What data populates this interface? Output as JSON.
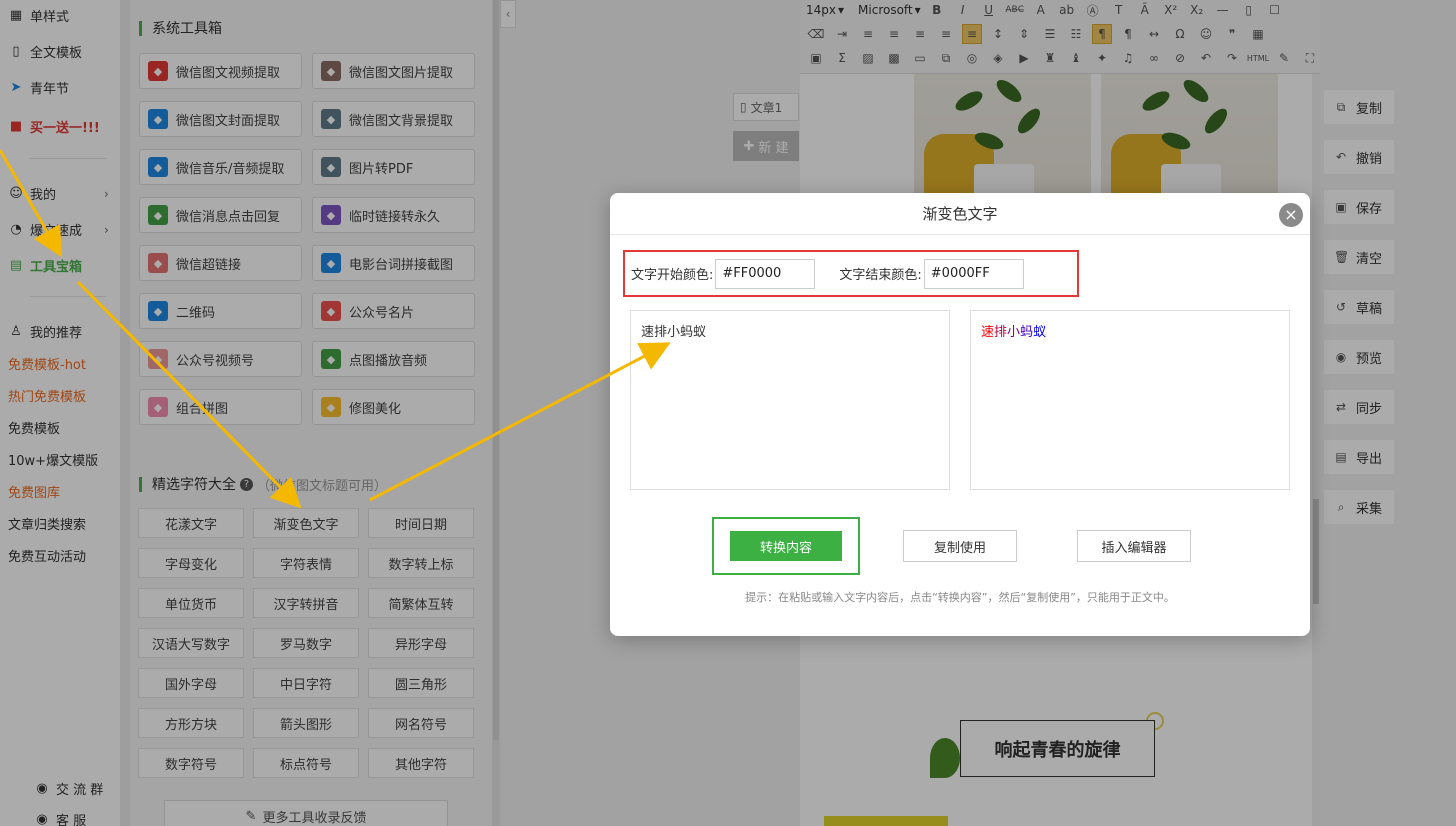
{
  "left_nav": {
    "items": [
      {
        "label": "单样式",
        "icon": "grid-icon"
      },
      {
        "label": "全文模板",
        "icon": "layout-icon"
      },
      {
        "label": "青年节",
        "icon": "paper-plane-icon"
      },
      {
        "label": "买一送一!!!",
        "icon": "gift-icon",
        "color": "#e53935"
      },
      {
        "label": "我的",
        "icon": "user-icon",
        "chevron": true
      },
      {
        "label": "爆文速成",
        "icon": "flame-icon",
        "chevron": true
      },
      {
        "label": "工具宝箱",
        "icon": "toolbox-icon",
        "color": "#4caf50"
      },
      {
        "label": "我的推荐",
        "icon": "thumbs-up-icon"
      },
      {
        "label": "免费模板-hot",
        "color": "#f06b1e"
      },
      {
        "label": "热门免费模板",
        "color": "#f06b1e"
      },
      {
        "label": "免费模板"
      },
      {
        "label": "10w+爆文模版"
      },
      {
        "label": "免费图库",
        "color": "#f06b1e"
      },
      {
        "label": "文章归类搜索"
      },
      {
        "label": "免费互动活动"
      }
    ],
    "bottom": [
      {
        "label": "交 流 群",
        "icon": "chat-icon"
      },
      {
        "label": "客 服",
        "icon": "headset-icon"
      }
    ]
  },
  "tools": {
    "section_title": "系统工具箱",
    "buttons": [
      {
        "label": "微信图文视频提取",
        "icon": "video-icon",
        "color": "#e53935"
      },
      {
        "label": "微信图文图片提取",
        "icon": "image-icon",
        "color": "#8d6e63"
      },
      {
        "label": "微信图文封面提取",
        "icon": "picture-icon",
        "color": "#1e88e5"
      },
      {
        "label": "微信图文背景提取",
        "icon": "background-icon",
        "color": "#607d8b"
      },
      {
        "label": "微信音乐/音频提取",
        "icon": "headphone-icon",
        "color": "#1e88e5"
      },
      {
        "label": "图片转PDF",
        "icon": "pdf-icon",
        "color": "#607d8b"
      },
      {
        "label": "微信消息点击回复",
        "icon": "message-icon",
        "color": "#43a047"
      },
      {
        "label": "临时链接转永久",
        "icon": "link-icon",
        "color": "#7e57c2"
      },
      {
        "label": "微信超链接",
        "icon": "hyperlink-icon",
        "color": "#e57373"
      },
      {
        "label": "电影台词拼接截图",
        "icon": "film-icon",
        "color": "#1e88e5"
      },
      {
        "label": "二维码",
        "icon": "qrcode-icon",
        "color": "#1e88e5"
      },
      {
        "label": "公众号名片",
        "icon": "card-icon",
        "color": "#ef5350"
      },
      {
        "label": "公众号视频号",
        "icon": "channel-icon",
        "color": "#ef9a9a"
      },
      {
        "label": "点图播放音频",
        "icon": "audio-icon",
        "color": "#43a047"
      },
      {
        "label": "组合拼图",
        "icon": "puzzle-icon",
        "color": "#f48fb1"
      },
      {
        "label": "修图美化",
        "icon": "retouch-icon",
        "color": "#fbc02d"
      }
    ]
  },
  "chars": {
    "section_title": "精选字符大全",
    "section_hint": "（微信图文标题可用）",
    "buttons": [
      "花漾文字",
      "渐变色文字",
      "时间日期",
      "字母变化",
      "字符表情",
      "数字转上标",
      "单位货币",
      "汉字转拼音",
      "简繁体互转",
      "汉语大写数字",
      "罗马数字",
      "异形字母",
      "国外字母",
      "中日字符",
      "圆三角形",
      "方形方块",
      "箭头图形",
      "网名符号",
      "数字符号",
      "标点符号",
      "其他字符"
    ],
    "feedback": "更多工具收录反馈"
  },
  "middle": {
    "article_tab": "文章1",
    "new_button": "新 建"
  },
  "editor": {
    "font_size": "14px",
    "font_family": "Microsoft",
    "banner_text": "响起青春的旋律"
  },
  "right_actions": [
    "复制",
    "撤销",
    "保存",
    "清空",
    "草稿",
    "预览",
    "同步",
    "导出",
    "采集"
  ],
  "modal": {
    "title": "渐变色文字",
    "start_label": "文字开始颜色:",
    "start_value": "#FF0000",
    "end_label": "文字结束颜色:",
    "end_value": "#0000FF",
    "input_text": "速排小蚂蚁",
    "output_chars": [
      {
        "ch": "速",
        "color": "#FF0000"
      },
      {
        "ch": "排",
        "color": "#BF0040"
      },
      {
        "ch": "小",
        "color": "#800080"
      },
      {
        "ch": "蚂",
        "color": "#4000BF"
      },
      {
        "ch": "蚁",
        "color": "#0000FF"
      }
    ],
    "convert_label": "转换内容",
    "copy_label": "复制使用",
    "insert_label": "插入编辑器",
    "tip": "提示：在粘贴或输入文字内容后，点击“转换内容”，然后“复制使用”，只能用于正文中。"
  }
}
